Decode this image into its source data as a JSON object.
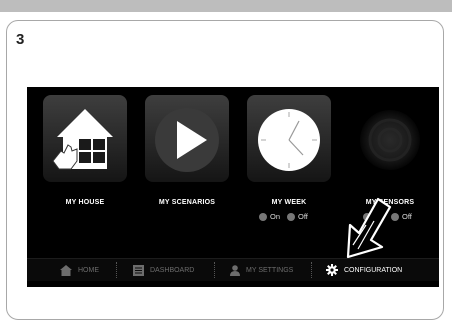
{
  "step_number": "3",
  "tiles": [
    {
      "label": "MY HOUSE",
      "icon": "house-hand-icon"
    },
    {
      "label": "MY SCENARIOS",
      "icon": "play-icon"
    },
    {
      "label": "MY WEEK",
      "icon": "clock-icon"
    },
    {
      "label": "MY SENSORS",
      "icon": "sensor-icon"
    }
  ],
  "week_toggle": {
    "on_label": "On",
    "off_label": "Off"
  },
  "sensors_toggle": {
    "on_label": "On",
    "off_label": "Off"
  },
  "nav": [
    {
      "label": "HOME",
      "icon": "house-icon",
      "active": false
    },
    {
      "label": "DASHBOARD",
      "icon": "dashboard-icon",
      "active": false
    },
    {
      "label": "MY SETTINGS",
      "icon": "user-icon",
      "active": false
    },
    {
      "label": "CONFIGURATION",
      "icon": "gear-icon",
      "active": true
    }
  ],
  "colors": {
    "screen_bg": "#000000",
    "active_nav": "#ffffff",
    "inactive_nav": "#6d6d6d"
  }
}
